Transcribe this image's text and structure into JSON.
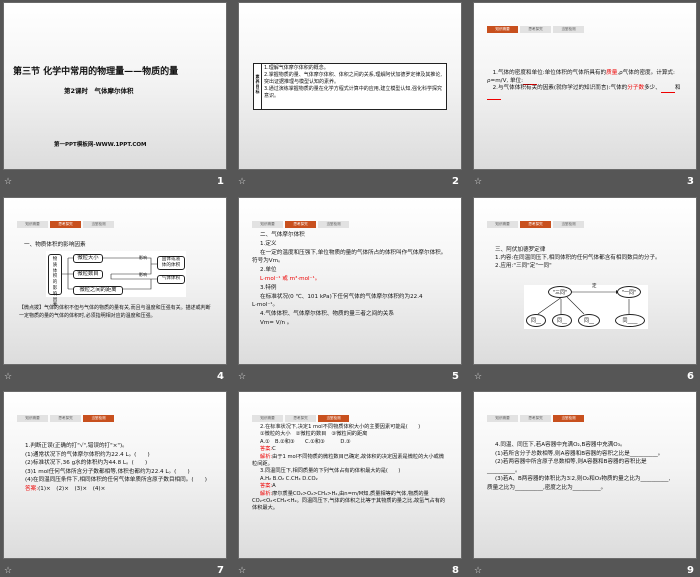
{
  "tabs": [
    "知识精要",
    "思考探究",
    "当堂检测"
  ],
  "slides": [
    {
      "number": "1",
      "title": "第三节 化学中常用的物理量——物质的量",
      "subtitle": "第2课时　气体摩尔体积",
      "footer": "第一PPT模板网-WWW.1PPT.COM"
    },
    {
      "number": "2",
      "side_label": "素养目标",
      "lines": [
        "1.理解气体摩尔体积的概念。",
        "2.掌握物质的量、气体摩尔体积、体积之间的关系,理解阿伏加德罗定律及其推论,突出证据推理与模型认知的素养。",
        "3.通过演练掌握物质的量在化学方程式计算中的应用,建立模型认知,强化科学探究意识。"
      ]
    },
    {
      "number": "3",
      "active_tab": 0,
      "l1": "1.气体的密度和单位:单位体积的气体所具有的",
      "l1b": "质量",
      "l1c": ",ρ气体的密度。计算式: ρ=m/V, 单位:",
      "l2": "2.与气体体积有关的因素(就你学过的知识而言):气体的",
      "l2b": "分子数",
      "l2c": "多少、",
      "l2d": "和"
    },
    {
      "number": "4",
      "active_tab": 1,
      "heading": "一、物质体积的影响因素",
      "factor": "物质体积的影响因素",
      "items": [
        "微粒大小",
        "微粒数目",
        "微粒之间的距离"
      ],
      "influence": "影响",
      "results": [
        "固体或液体的体积",
        "气体体积"
      ],
      "note": "【微点拨】气体的体积不但与气体的物质的量有关,而且与温度和压强有关。描述或判断一定物质的量的气体的体积时,必须指明相对应的温度和压强。"
    },
    {
      "number": "5",
      "active_tab": 1,
      "lines": [
        "二、气体摩尔体积",
        "1.定义",
        "在一定的温度和压强下,单位物质的量的气体所占的体积叫作气体摩尔体积。符号为Vm。",
        "2.单位",
        "L·mol⁻¹ 或 m³·mol⁻¹。",
        "3.特例",
        "在标准状况(0 ℃、101 kPa)下任何气体的气体摩尔体积约为22.4 L·mol⁻¹。",
        "4.气体体积、气体摩尔体积、物质的量三者之间的关系",
        "Vm= V/n 。"
      ]
    },
    {
      "number": "6",
      "active_tab": 1,
      "lines": [
        "三、阿伏加德罗定律",
        "1.内容:在同温同压下,相同体积的任何气体都含有相同数目的分子。",
        "2.应用:\"三同\"定\"一同\""
      ],
      "diagram": {
        "three": "\"三同\"",
        "one": "\"一同\"",
        "arrow": "定",
        "nodes": [
          "同__",
          "同__",
          "同__",
          "同____"
        ]
      }
    },
    {
      "number": "7",
      "active_tab": 2,
      "lines": [
        "1.判断正误(正确的打\"√\",错误的打\"×\")。",
        "(1)通常状况下的气体摩尔体积约为22.4 L。(　　)",
        "(2)标准状况下,36 g水的体积约为44.8 L。(　　)",
        "(3)1 mol任何气体所含分子数都相等,体积也都约为22.4 L。(　　)",
        "(4)在同温同压条件下,相同体积的任何气体单质所含原子数目相同。(　　)"
      ],
      "answer_label": "答案:",
      "answer": "(1)×　(2)×　(3)×　(4)×"
    },
    {
      "number": "8",
      "active_tab": 2,
      "q2": "2.在标准状况下,决定1 mol不同物质体积大小的主要因素可能是(　　)",
      "q2opts": "①微粒的大小　②微粒的数目　③微粒间的距离",
      "q2choices": "A.①　B.②和③　　C.①和③　　　D.③",
      "answer_label": "答案:",
      "q2ans": "C",
      "analysis_label": "解析:",
      "q2exp": "由于1 mol不同物质的微粒数目已确定,故体积的决定因素是微粒的大小或微粒间距。",
      "q3": "3.同温同压下,相同质量的下列气体占有的体积最大的是(　　)",
      "q3choices": "A.H₂  B.O₂  C.CH₄ D.CO₂",
      "q3ans": "A",
      "q3exp": "摩尔质量CO₂>O₂>CH₄>H₂,由n=m/M知,质量相等的气体,物质的量CO₂<O₂<CH₄<H₂。同温同压下,气体的体积之比等于其物质的量之比,故氢气占有的体积最大。"
    },
    {
      "number": "9",
      "active_tab": 2,
      "lines": [
        "4.同温、同压下,若A容器中充满O₂,B容器中充满O₃。",
        "(1)若所含分子总数相等,则A容器和B容器的容积之比是__________。",
        "(2)若两容器中所含原子总数相等,则A容器和B容器的容积比是__________。",
        "(3)若A、B两容器的体积比为3∶2,则O₂和O₃物质的量之比为__________,质量之比为__________,密度之比为__________。"
      ]
    }
  ],
  "colors": {
    "background": "#565656",
    "tab_active": "#c8501e",
    "answer_red": "#e00000"
  }
}
